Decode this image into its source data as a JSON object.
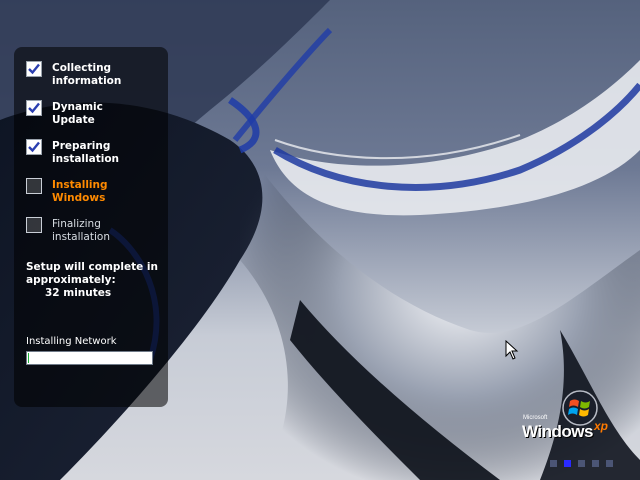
{
  "steps": [
    {
      "label": "Collecting\ninformation",
      "state": "done"
    },
    {
      "label": "Dynamic\nUpdate",
      "state": "done"
    },
    {
      "label": "Preparing\ninstallation",
      "state": "done"
    },
    {
      "label": "Installing\nWindows",
      "state": "active"
    },
    {
      "label": "Finalizing\ninstallation",
      "state": "pending"
    }
  ],
  "eta": {
    "line1": "Setup will complete in",
    "line2": "approximately:",
    "minutes": "32 minutes"
  },
  "progress": {
    "label": "Installing Network",
    "value_percent": 1
  },
  "logo": {
    "brand": "Microsoft",
    "name": "Windows",
    "suffix": "xp"
  },
  "page_indicator": {
    "count": 5,
    "active_index": 1
  },
  "colors": {
    "active_step": "#ff8a00",
    "progress_fill": "#1db33a",
    "check": "#2b3fb0"
  },
  "icons": {
    "check": "checkmark-icon",
    "logo": "windows-flag-icon",
    "cursor": "mouse-pointer-icon"
  }
}
